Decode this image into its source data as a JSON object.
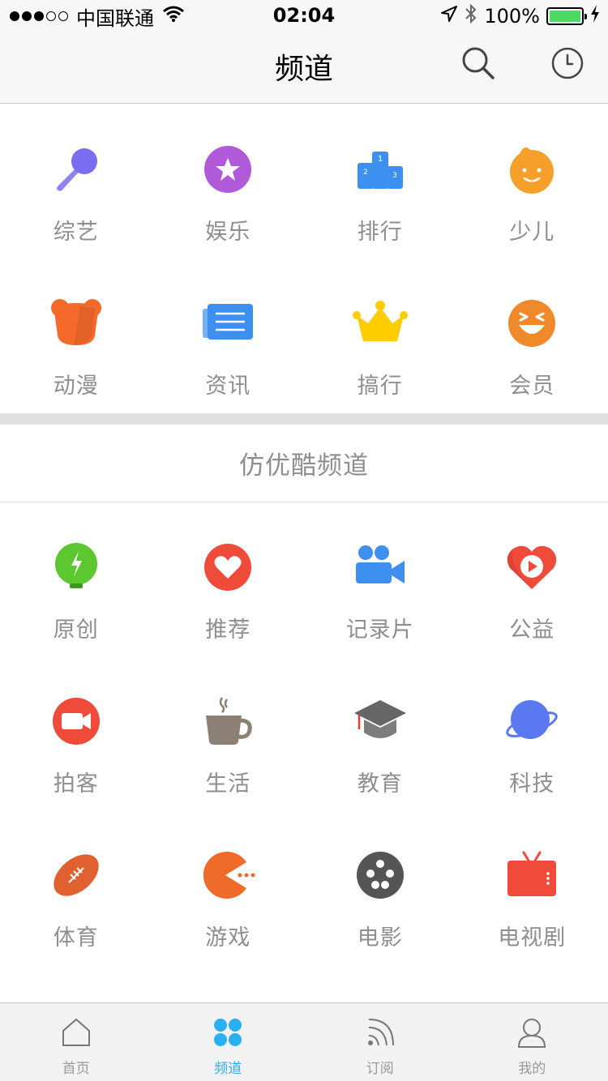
{
  "status_bar": {
    "carrier": "中国联通",
    "time": "02:04",
    "battery_percent": "100%",
    "battery_level": 1.0,
    "signal_bars_filled": 3,
    "signal_bars_total": 5
  },
  "nav": {
    "title": "频道"
  },
  "top_channels": [
    {
      "label": "综艺",
      "icon": "microphone-icon",
      "color": "#7b6cf0"
    },
    {
      "label": "娱乐",
      "icon": "star-badge-icon",
      "color": "#b05ad9"
    },
    {
      "label": "排行",
      "icon": "podium-icon",
      "color": "#3d8ff0"
    },
    {
      "label": "少儿",
      "icon": "kid-face-icon",
      "color": "#f5a02a"
    },
    {
      "label": "动漫",
      "icon": "bear-icon",
      "color": "#f56a2a"
    },
    {
      "label": "资讯",
      "icon": "newspaper-icon",
      "color": "#3d8ff0"
    },
    {
      "label": "搞行",
      "icon": "crown-icon",
      "color": "#ffcc00"
    },
    {
      "label": "会员",
      "icon": "laughing-face-icon",
      "color": "#f0892a"
    }
  ],
  "section": {
    "title": "仿优酷频道"
  },
  "more_channels": [
    {
      "label": "原创",
      "icon": "lightbulb-icon",
      "color": "#5cc72e"
    },
    {
      "label": "推荐",
      "icon": "heart-icon",
      "color": "#f04a3a"
    },
    {
      "label": "记录片",
      "icon": "video-camera-icon",
      "color": "#3d8ff0"
    },
    {
      "label": "公益",
      "icon": "heart-play-icon",
      "color": "#f04a3a"
    },
    {
      "label": "拍客",
      "icon": "camera-icon",
      "color": "#f04a3a"
    },
    {
      "label": "生活",
      "icon": "coffee-cup-icon",
      "color": "#8c7f74"
    },
    {
      "label": "教育",
      "icon": "graduation-cap-icon",
      "color": "#666666"
    },
    {
      "label": "科技",
      "icon": "planet-icon",
      "color": "#5a78f0"
    },
    {
      "label": "体育",
      "icon": "football-icon",
      "color": "#e06030"
    },
    {
      "label": "游戏",
      "icon": "pacman-icon",
      "color": "#f06a2a"
    },
    {
      "label": "电影",
      "icon": "film-reel-icon",
      "color": "#555555"
    },
    {
      "label": "电视剧",
      "icon": "tv-icon",
      "color": "#f04a3a"
    }
  ],
  "tabs": [
    {
      "label": "首页",
      "icon": "home-icon",
      "active": false
    },
    {
      "label": "频道",
      "icon": "channels-grid-icon",
      "active": true
    },
    {
      "label": "订阅",
      "icon": "rss-icon",
      "active": false
    },
    {
      "label": "我的",
      "icon": "user-icon",
      "active": false
    }
  ],
  "colors": {
    "accent": "#2ab0f0",
    "label_gray": "#8e8e8e",
    "nav_bg": "#f7f7f7",
    "tab_bg": "#f2f2f2"
  }
}
